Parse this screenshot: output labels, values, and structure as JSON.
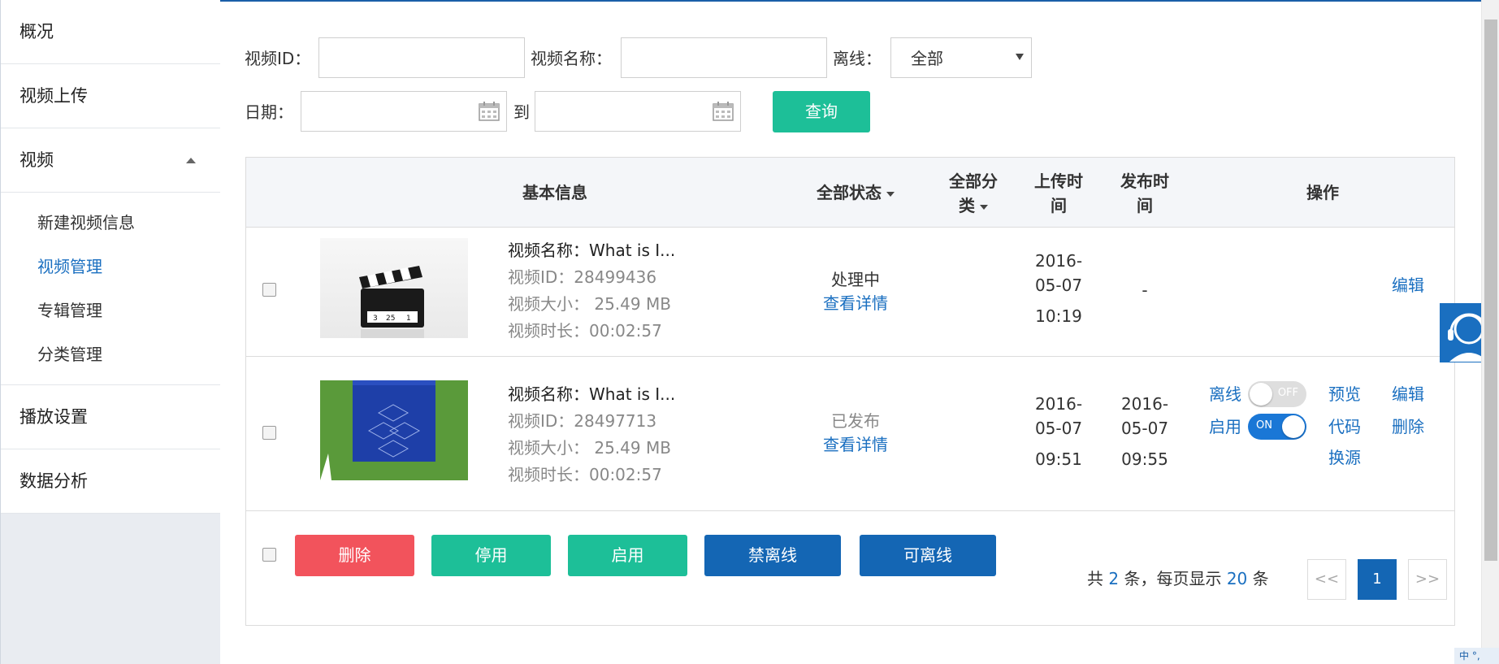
{
  "sidebar": {
    "items": [
      {
        "label": "概况"
      },
      {
        "label": "视频上传"
      },
      {
        "label": "视频"
      },
      {
        "label": "播放设置"
      },
      {
        "label": "数据分析"
      }
    ],
    "sub_items": [
      {
        "label": "新建视频信息"
      },
      {
        "label": "视频管理"
      },
      {
        "label": "专辑管理"
      },
      {
        "label": "分类管理"
      }
    ]
  },
  "filters": {
    "video_id_label": "视频ID：",
    "video_id_value": "",
    "video_name_label": "视频名称：",
    "video_name_value": "",
    "offline_label": "离线：",
    "offline_selected": "全部",
    "date_label": "日期：",
    "date_to_label": "到",
    "date_from_value": "",
    "date_to_value": "",
    "query_button": "查询"
  },
  "table": {
    "headers": {
      "basic_info": "基本信息",
      "all_status": "全部状态",
      "all_category_line1": "全部分",
      "all_category_line2": "类",
      "upload_time_line1": "上传时",
      "upload_time_line2": "间",
      "publish_time_line1": "发布时",
      "publish_time_line2": "间",
      "actions": "操作"
    },
    "rows": [
      {
        "name": "视频名称：What is I...",
        "id": "视频ID：28499436",
        "size": "视频大小： 25.49 MB",
        "duration": "视频时长：00:02:57",
        "status": "处理中",
        "detail_link": "查看详情",
        "upload_date_1": "2016-",
        "upload_date_2": "05-07",
        "upload_time": "10:19",
        "publish": "-",
        "edit": "编辑"
      },
      {
        "name": "视频名称：What is I...",
        "id": "视频ID：28497713",
        "size": "视频大小： 25.49 MB",
        "duration": "视频时长：00:02:57",
        "status": "已发布",
        "detail_link": "查看详情",
        "upload_date_1": "2016-",
        "upload_date_2": "05-07",
        "upload_time": "09:51",
        "publish_date_1": "2016-",
        "publish_date_2": "05-07",
        "publish_time": "09:55",
        "offline_label": "离线",
        "offline_toggle": "OFF",
        "enable_label": "启用",
        "enable_toggle": "ON",
        "preview": "预览",
        "edit": "编辑",
        "code": "代码",
        "delete": "删除",
        "change_source": "换源"
      }
    ]
  },
  "bulk_actions": {
    "delete": "删除",
    "disable": "停用",
    "enable": "启用",
    "forbid_offline": "禁离线",
    "allow_offline": "可离线"
  },
  "pagination": {
    "total_prefix": "共",
    "total_count": "2",
    "total_mid": "条，每页显示",
    "per_page": "20",
    "total_suffix": "条",
    "prev": "<<",
    "current": "1",
    "next": ">>"
  },
  "ime": {
    "label": "中 °,"
  },
  "colors": {
    "primary_blue": "#1466b4",
    "green": "#1dbf98",
    "red": "#f2535c",
    "link": "#1a6fc0"
  }
}
